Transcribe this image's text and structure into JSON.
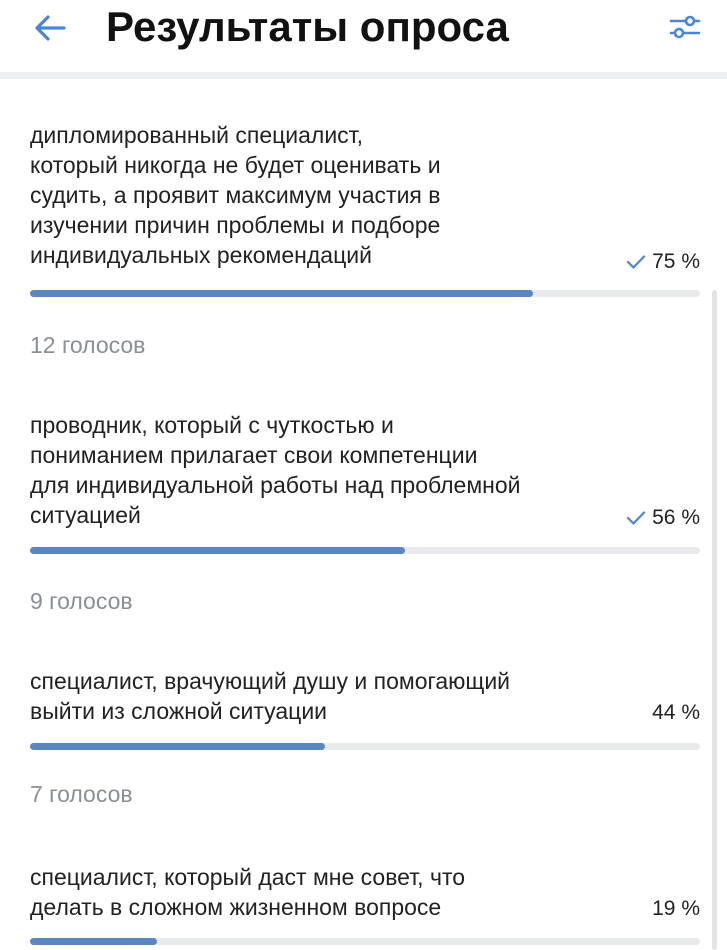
{
  "header": {
    "title": "Результаты опроса",
    "back_icon": "arrow-left-icon",
    "filter_icon": "sliders-icon",
    "accent_color": "#4a86d6"
  },
  "options": [
    {
      "text": "дипломированный специалист,\nкоторый никогда не будет оценивать и\nсудить, а проявит максимум участия в\nизучении причин проблемы и подборе\nиндивидуальных рекомендаций",
      "percent_label": "75 %",
      "percent": 75,
      "checked": true,
      "votes": "12 голосов"
    },
    {
      "text": "проводник, который с чуткостью и\nпониманием прилагает свои компетенции\nдля индивидуальной работы над проблемной\nситуацией",
      "percent_label": "56 %",
      "percent": 56,
      "checked": true,
      "votes": "9 голосов"
    },
    {
      "text": "специалист, врачующий душу и помогающий\nвыйти из сложной ситуации",
      "percent_label": "44 %",
      "percent": 44,
      "checked": false,
      "votes": "7 голосов"
    },
    {
      "text": "специалист, который даст мне совет, что\nделать в сложном жизненном вопросе",
      "percent_label": "19 %",
      "percent": 19,
      "checked": false,
      "votes": ""
    }
  ],
  "colors": {
    "bar_fill": "#5a87c2",
    "bar_track": "#e8eaee",
    "votes_text": "#8a8f96"
  }
}
